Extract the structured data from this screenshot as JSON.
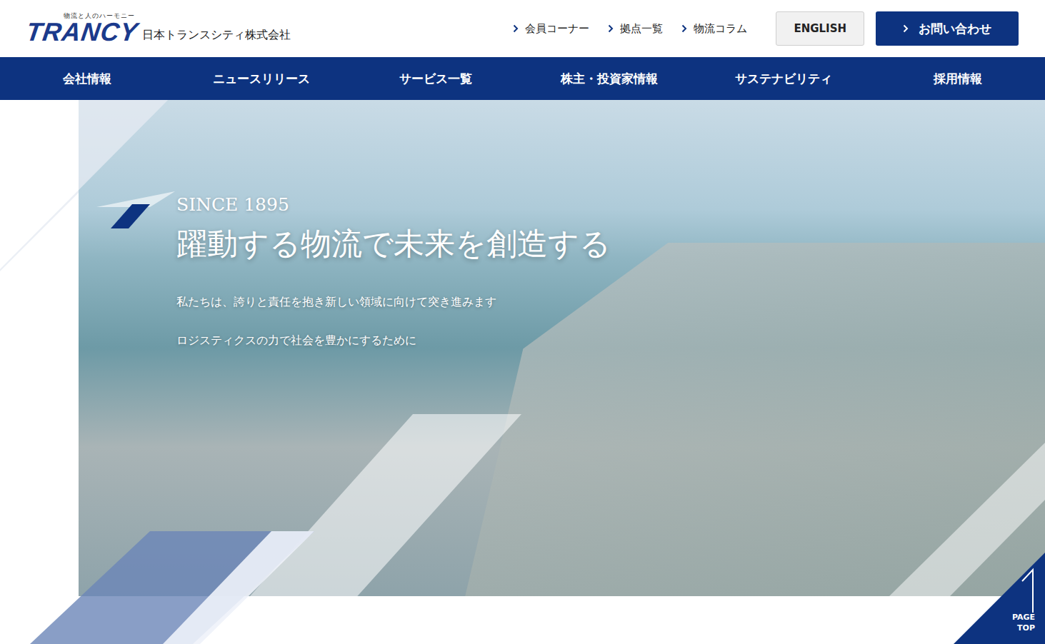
{
  "header": {
    "logo": {
      "wordmark": "TRANCY",
      "tagline": "物流と人のハーモニー",
      "company": "日本トランスシティ株式会社"
    },
    "utility_links": [
      "会員コーナー",
      "拠点一覧",
      "物流コラム"
    ],
    "english_button": "ENGLISH",
    "contact_button": "お問い合わせ"
  },
  "nav": {
    "items": [
      "会社情報",
      "ニュースリリース",
      "サービス一覧",
      "株主・投資家情報",
      "サステナビリティ",
      "採用情報"
    ]
  },
  "hero": {
    "since": "SINCE 1895",
    "title": "躍動する物流で未来を創造する",
    "lines": [
      "私たちは、誇りと責任を抱き新しい領域に向けて突き進みます",
      "ロジスティクスの力で社会を豊かにするために"
    ]
  },
  "page_top": {
    "lines": [
      "PAGE",
      "TOP"
    ]
  }
}
